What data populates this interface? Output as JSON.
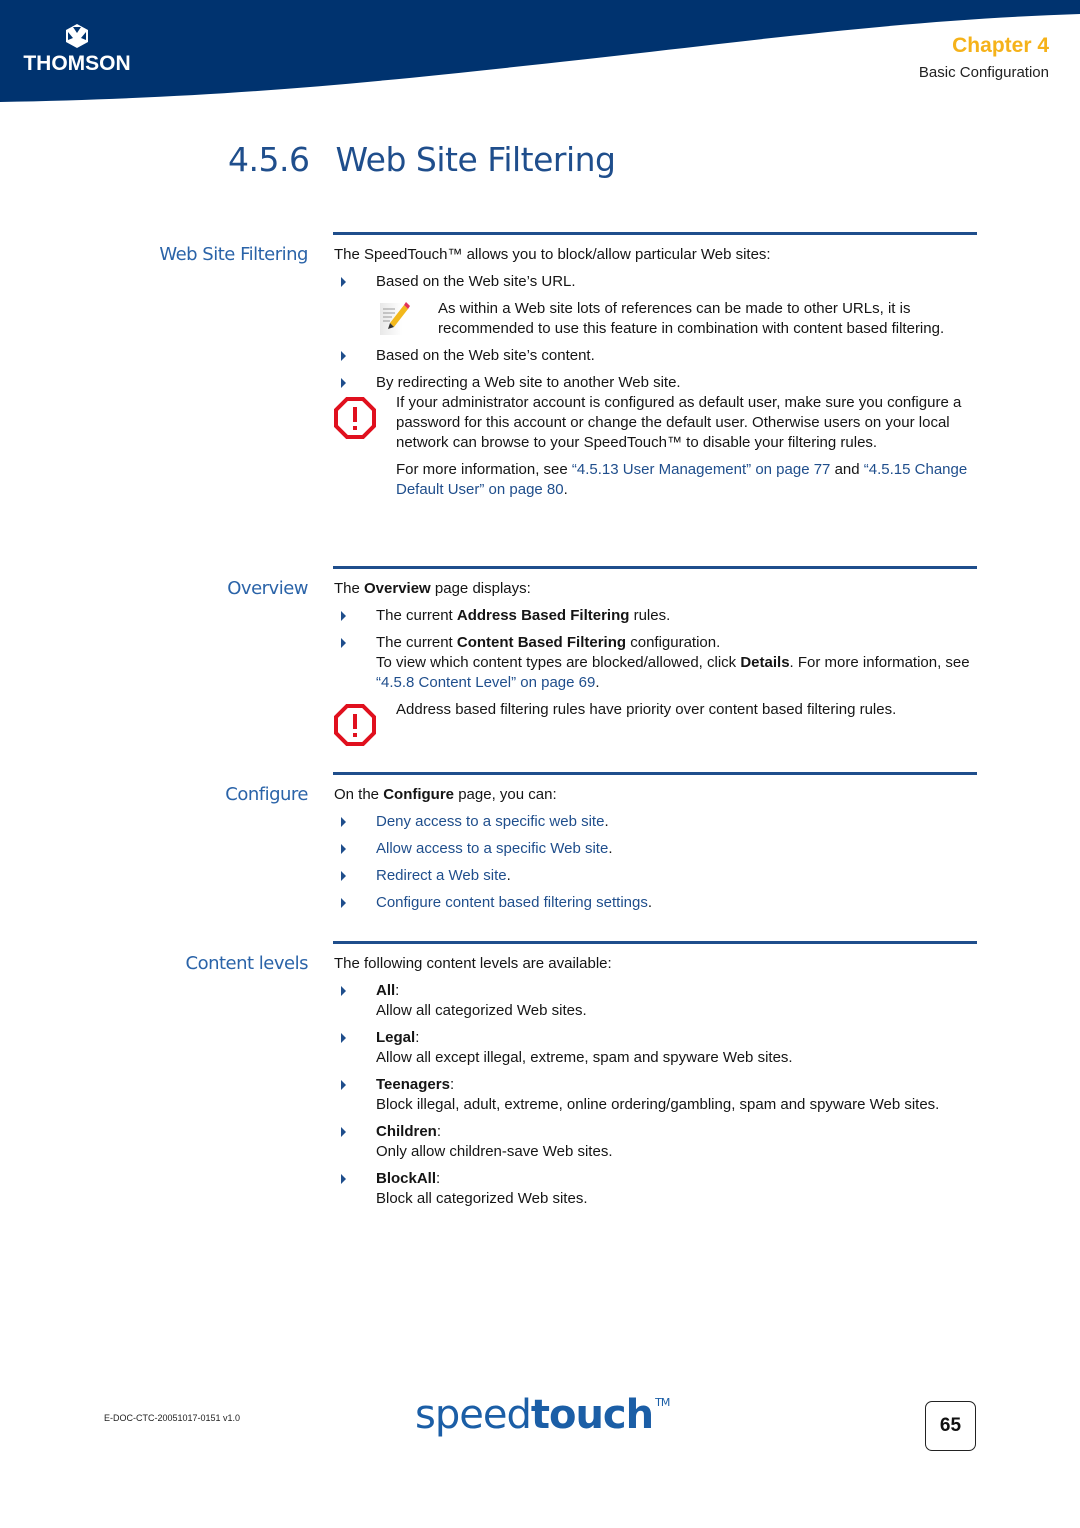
{
  "header": {
    "brand": "THOMSON",
    "chapter_title": "Chapter 4",
    "chapter_subtitle": "Basic Configuration",
    "colors": {
      "band": "#00336f",
      "chapter": "#f5b21a",
      "accent": "#1f4e8c"
    }
  },
  "title": {
    "number": "4.5.6",
    "text": "Web Site Filtering"
  },
  "sections": {
    "filtering": {
      "label": "Web Site Filtering",
      "intro": "The SpeedTouch™ allows you to block/allow particular Web sites:",
      "bullet1": "Based on the Web site’s URL.",
      "note": "As within a Web site lots of references can be made to other URLs, it is recommended to use this feature in combination with content based filtering.",
      "bullet2": "Based on the Web site’s content.",
      "bullet3": "By redirecting a Web site to another Web site.",
      "warning": "If your administrator account is configured as default user, make sure you configure a password for this account or change the default user. Otherwise users on your local network can browse to your SpeedTouch™ to disable your filtering rules.",
      "more_prefix": "For more information, see ",
      "link1": "“4.5.13 User Management” on page 77",
      "more_mid": " and ",
      "link2": "“4.5.15 Change Default User” on page 80",
      "more_suffix": "."
    },
    "overview": {
      "label": "Overview",
      "intro_pre": "The ",
      "intro_bold": "Overview",
      "intro_post": " page displays:",
      "b1_pre": "The current ",
      "b1_bold": "Address Based Filtering",
      "b1_post": " rules.",
      "b2_pre": "The current ",
      "b2_bold": "Content Based Filtering",
      "b2_post": " configuration.",
      "b2_line2_pre": "To view which content types are blocked/allowed, click ",
      "b2_line2_bold": "Details",
      "b2_line2_mid": ". For more information, see ",
      "b2_link": "“4.5.8 Content Level” on page 69",
      "b2_line2_post": ".",
      "warning": "Address based filtering rules have priority over content based filtering rules."
    },
    "configure": {
      "label": "Configure",
      "intro_pre": "On the ",
      "intro_bold": "Configure",
      "intro_post": " page, you can:",
      "links": [
        "Deny access to a specific web site",
        "Allow access to a specific Web site",
        "Redirect a Web site",
        "Configure content based filtering settings"
      ]
    },
    "content_levels": {
      "label": "Content levels",
      "intro": "The following content levels are available:",
      "levels": [
        {
          "name": "All",
          "desc": "Allow all categorized Web sites."
        },
        {
          "name": "Legal",
          "desc": "Allow all except illegal, extreme, spam and spyware Web sites."
        },
        {
          "name": "Teenagers",
          "desc": "Block illegal, adult, extreme, online ordering/gambling, spam and spyware Web sites."
        },
        {
          "name": "Children",
          "desc": "Only allow children-save Web sites."
        },
        {
          "name": "BlockAll",
          "desc": "Block all categorized Web sites."
        }
      ]
    }
  },
  "footer": {
    "doc_id": "E-DOC-CTC-20051017-0151 v1.0",
    "brand_light": "speed",
    "brand_bold": "touch",
    "brand_tm": "TM",
    "page_number": "65"
  }
}
